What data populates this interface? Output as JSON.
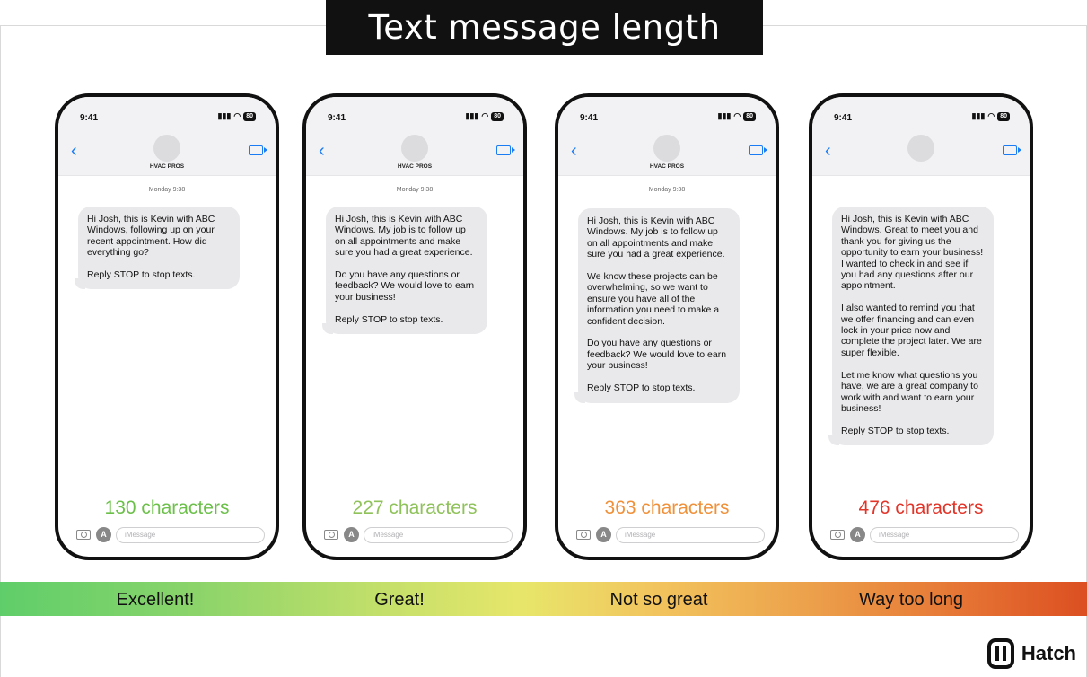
{
  "title": "Text message length",
  "phones": [
    {
      "time": "9:41",
      "battery": "80",
      "contact": "HVAC PROS",
      "date": "Monday 9:38",
      "message": "Hi Josh, this is Kevin with ABC Windows, following up on your recent appointment. How did everything go?\n\nReply STOP to stop texts.",
      "char_count": "130 characters",
      "count_color": "#6cc04a",
      "input_placeholder": "iMessage"
    },
    {
      "time": "9:41",
      "battery": "80",
      "contact": "HVAC PROS",
      "date": "Monday 9:38",
      "message": "Hi Josh, this is Kevin with ABC Windows. My job is to follow up on all appointments and make sure you had a great experience.\n\nDo you have any questions or feedback? We would love to earn your business!\n\nReply STOP to stop texts.",
      "char_count": "227 characters",
      "count_color": "#8fc25a",
      "input_placeholder": "iMessage"
    },
    {
      "time": "9:41",
      "battery": "80",
      "contact": "HVAC PROS",
      "date": "Monday 9:38",
      "message": "Hi Josh, this is Kevin with ABC Windows. My job is to follow up on all appointments and make sure you had a great experience.\n\nWe know these projects can be overwhelming, so we want to ensure you have all of the information you need to make a confident decision.\n\nDo you have any questions or feedback? We would love to earn your business!\n\nReply STOP to stop texts.",
      "char_count": "363 characters",
      "count_color": "#f0913a",
      "input_placeholder": "iMessage"
    },
    {
      "time": "9:41",
      "battery": "80",
      "contact": "",
      "date": "",
      "message": "Hi Josh, this is Kevin with ABC Windows. Great to meet you and thank you for giving us the opportunity to earn your business! I wanted to check in and see if you had any questions after our appointment.\n\nI also wanted to remind you that we offer financing and can even lock in your price now and complete the project later. We are super flexible.\n\nLet me know what questions you have, we are a great company to work with and want to earn your business!\n\nReply STOP to stop texts.",
      "char_count": "476 characters",
      "count_color": "#e2352a",
      "input_placeholder": "iMessage"
    }
  ],
  "scale": {
    "labels": [
      "Excellent!",
      "Great!",
      "Not so great",
      "Way too long"
    ]
  },
  "brand": {
    "name": "Hatch"
  }
}
